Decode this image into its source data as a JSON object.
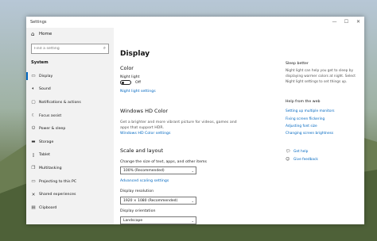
{
  "window": {
    "title": "Settings"
  },
  "sidebar": {
    "home_label": "Home",
    "search_placeholder": "Find a setting",
    "section_title": "System",
    "items": [
      {
        "label": "Display",
        "icon": "display-icon",
        "active": true
      },
      {
        "label": "Sound",
        "icon": "sound-icon"
      },
      {
        "label": "Notifications & actions",
        "icon": "notifications-icon"
      },
      {
        "label": "Focus assist",
        "icon": "focus-assist-icon"
      },
      {
        "label": "Power & sleep",
        "icon": "power-icon"
      },
      {
        "label": "Storage",
        "icon": "storage-icon"
      },
      {
        "label": "Tablet",
        "icon": "tablet-icon"
      },
      {
        "label": "Multitasking",
        "icon": "multitasking-icon"
      },
      {
        "label": "Projecting to this PC",
        "icon": "projecting-icon"
      },
      {
        "label": "Shared experiences",
        "icon": "shared-experiences-icon"
      },
      {
        "label": "Clipboard",
        "icon": "clipboard-icon"
      }
    ]
  },
  "main": {
    "page_title": "Display",
    "color": {
      "heading": "Color",
      "night_light_label": "Night light",
      "night_light_state": "Off",
      "night_light_settings_link": "Night light settings"
    },
    "hd_color": {
      "heading": "Windows HD Color",
      "description": "Get a brighter and more vibrant picture for videos, games and apps that support HDR.",
      "settings_link": "Windows HD Color settings"
    },
    "scale": {
      "heading": "Scale and layout",
      "size_label": "Change the size of text, apps, and other items",
      "size_value": "100% (Recommended)",
      "advanced_link": "Advanced scaling settings",
      "resolution_label": "Display resolution",
      "resolution_value": "1920 × 1080 (Recommended)",
      "orientation_label": "Display orientation",
      "orientation_value": "Landscape"
    }
  },
  "right_panel": {
    "sleep_title": "Sleep better",
    "sleep_text": "Night light can help you get to sleep by displaying warmer colors at night. Select Night light settings to set things up.",
    "help_title": "Help from the web",
    "help_links": [
      "Setting up multiple monitors",
      "Fixing screen flickering",
      "Adjusting font size",
      "Changing screen brightness"
    ],
    "get_help": "Get help",
    "give_feedback": "Give feedback"
  }
}
